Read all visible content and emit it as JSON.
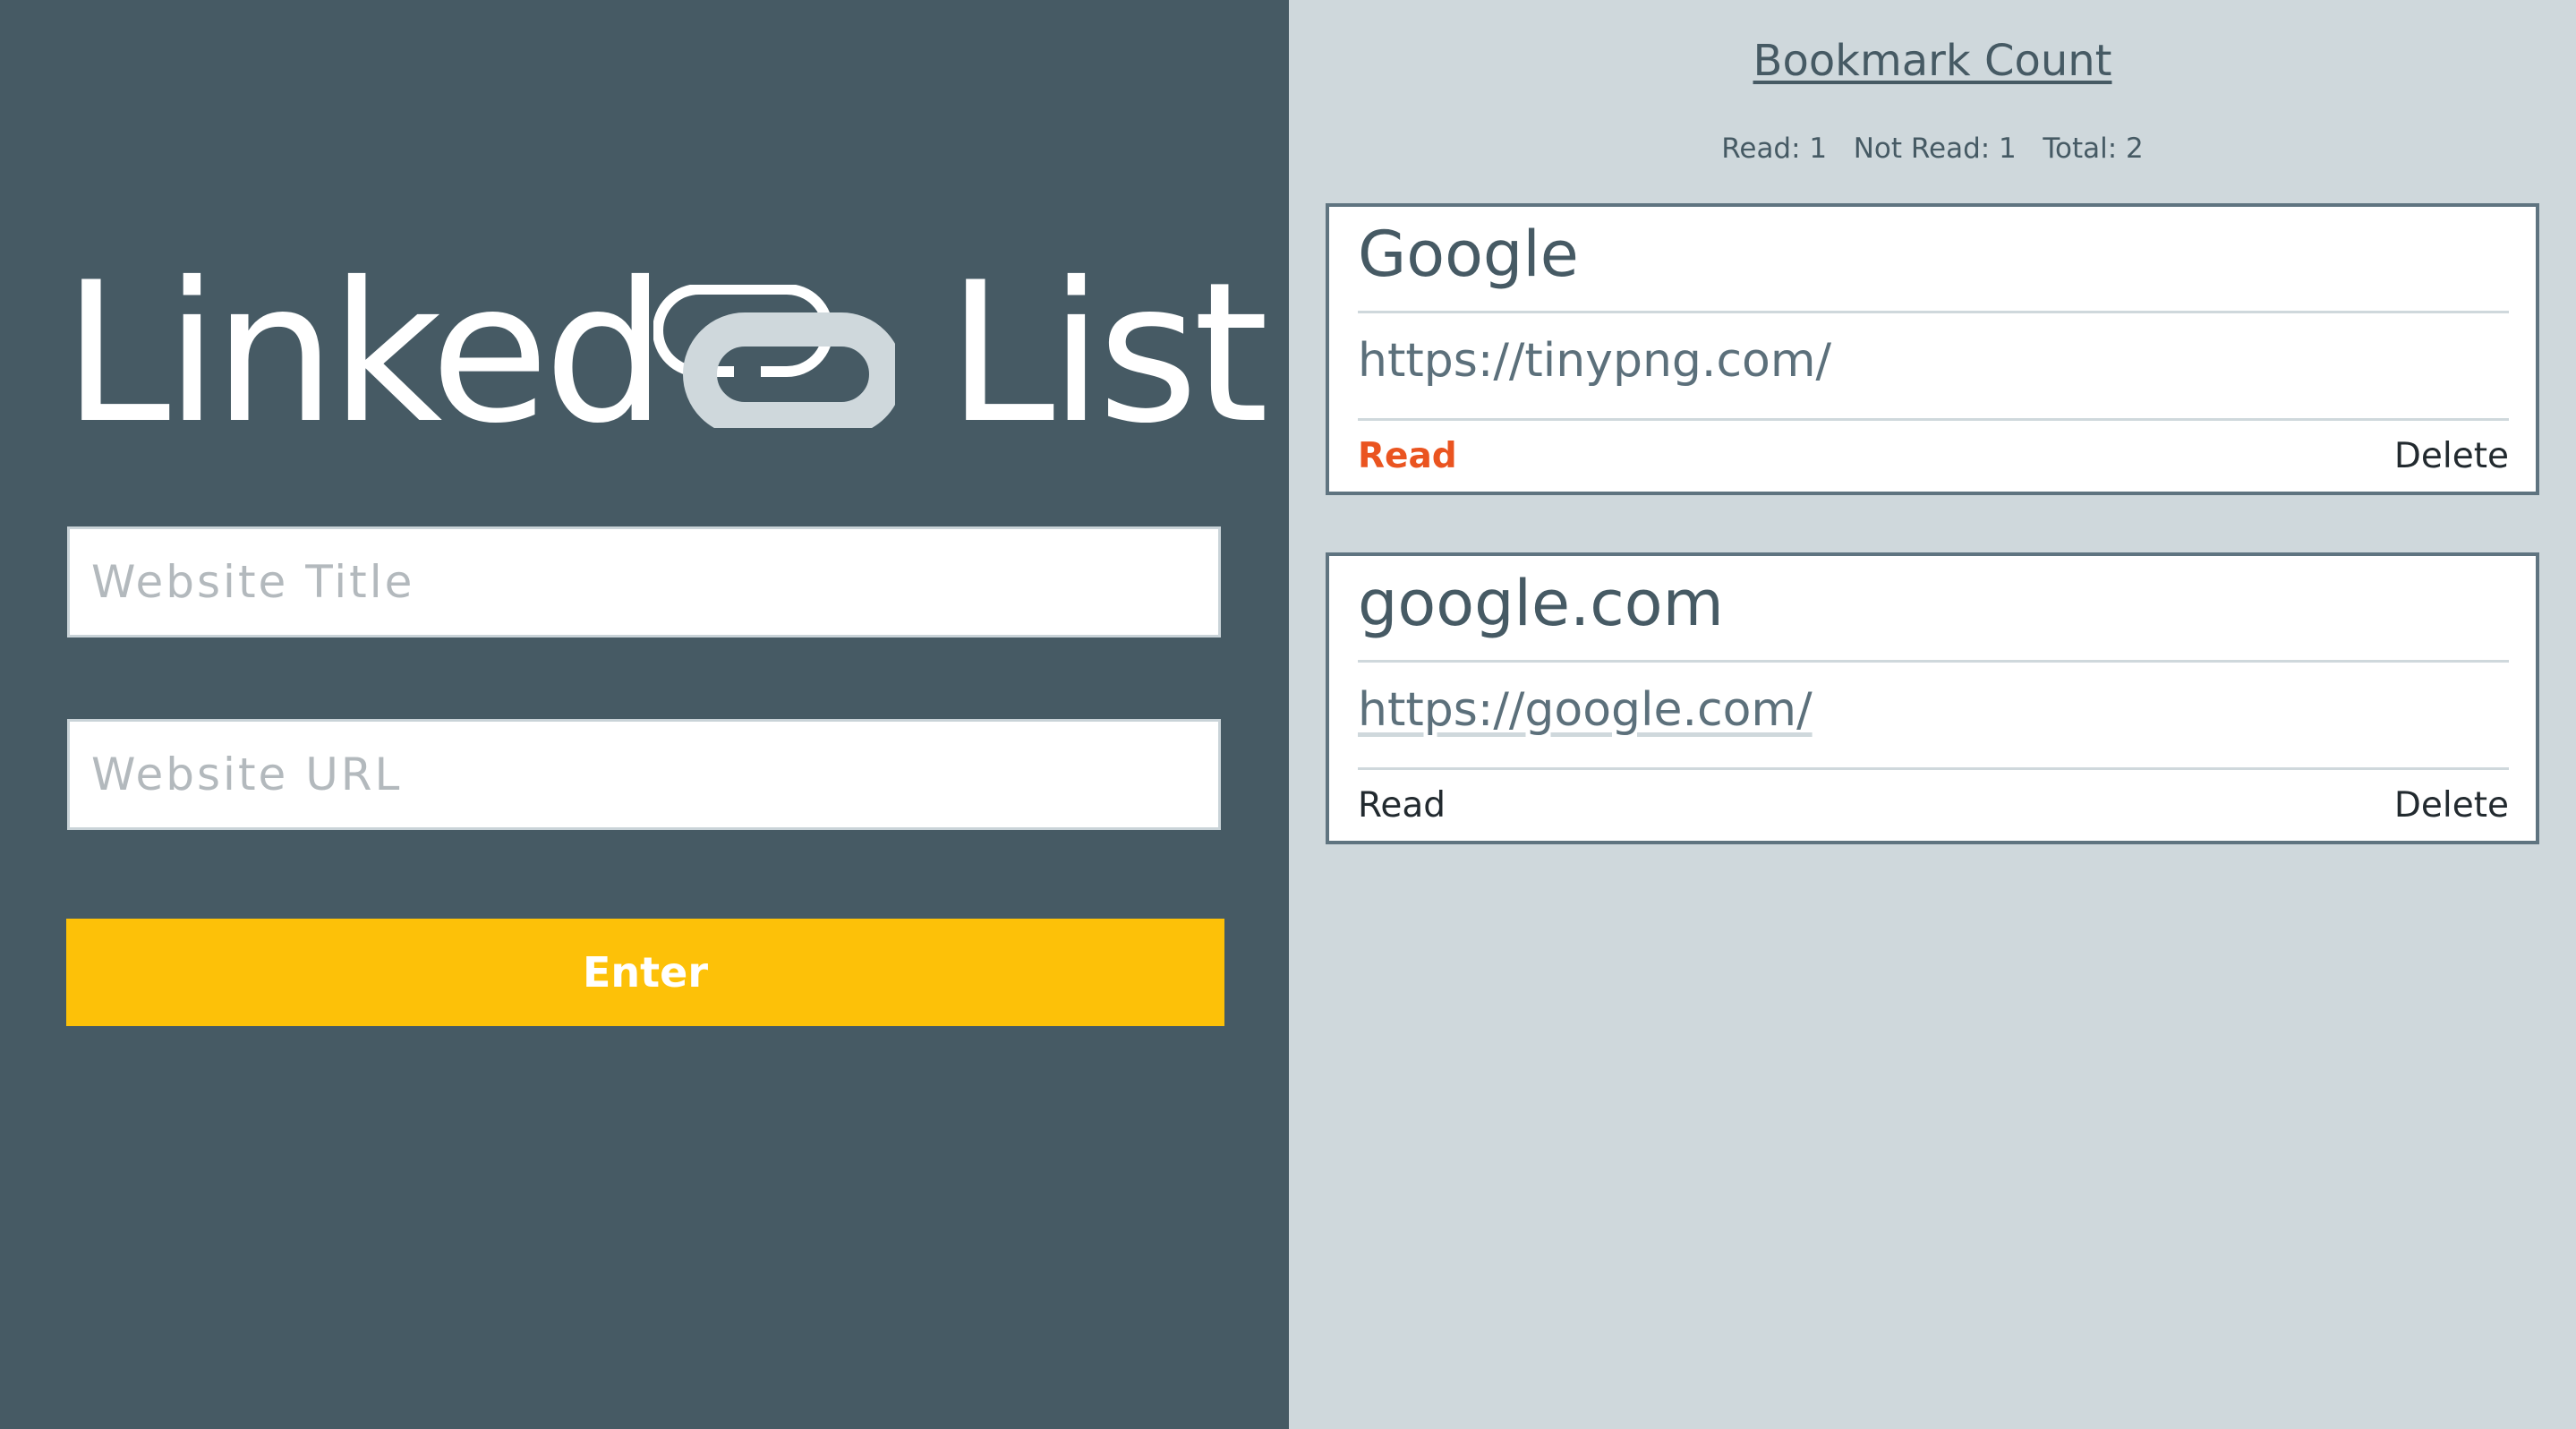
{
  "header": {
    "logo_word_1": "Linked",
    "logo_word_2": "List",
    "logo_icon": "paperclip-link-icon"
  },
  "form": {
    "title_placeholder": "Website Title",
    "url_placeholder": "Website URL",
    "enter_label": "Enter"
  },
  "sidebar": {
    "heading": "Bookmark Count",
    "stats": "Read: 1   Not Read: 1   Total: 2"
  },
  "bookmarks": [
    {
      "title": "Google",
      "url": "https://tinypng.com/",
      "read_label": "Read",
      "delete_label": "Delete",
      "is_read": true
    },
    {
      "title": "google.com",
      "url": "https://google.com/",
      "read_label": "Read",
      "delete_label": "Delete",
      "is_read": false
    }
  ],
  "colors": {
    "left_panel": "#465a64",
    "right_panel": "#cfd8dc",
    "accent_button": "#fdc108",
    "read_active": "#ea5420",
    "card_border": "#5f7480"
  }
}
